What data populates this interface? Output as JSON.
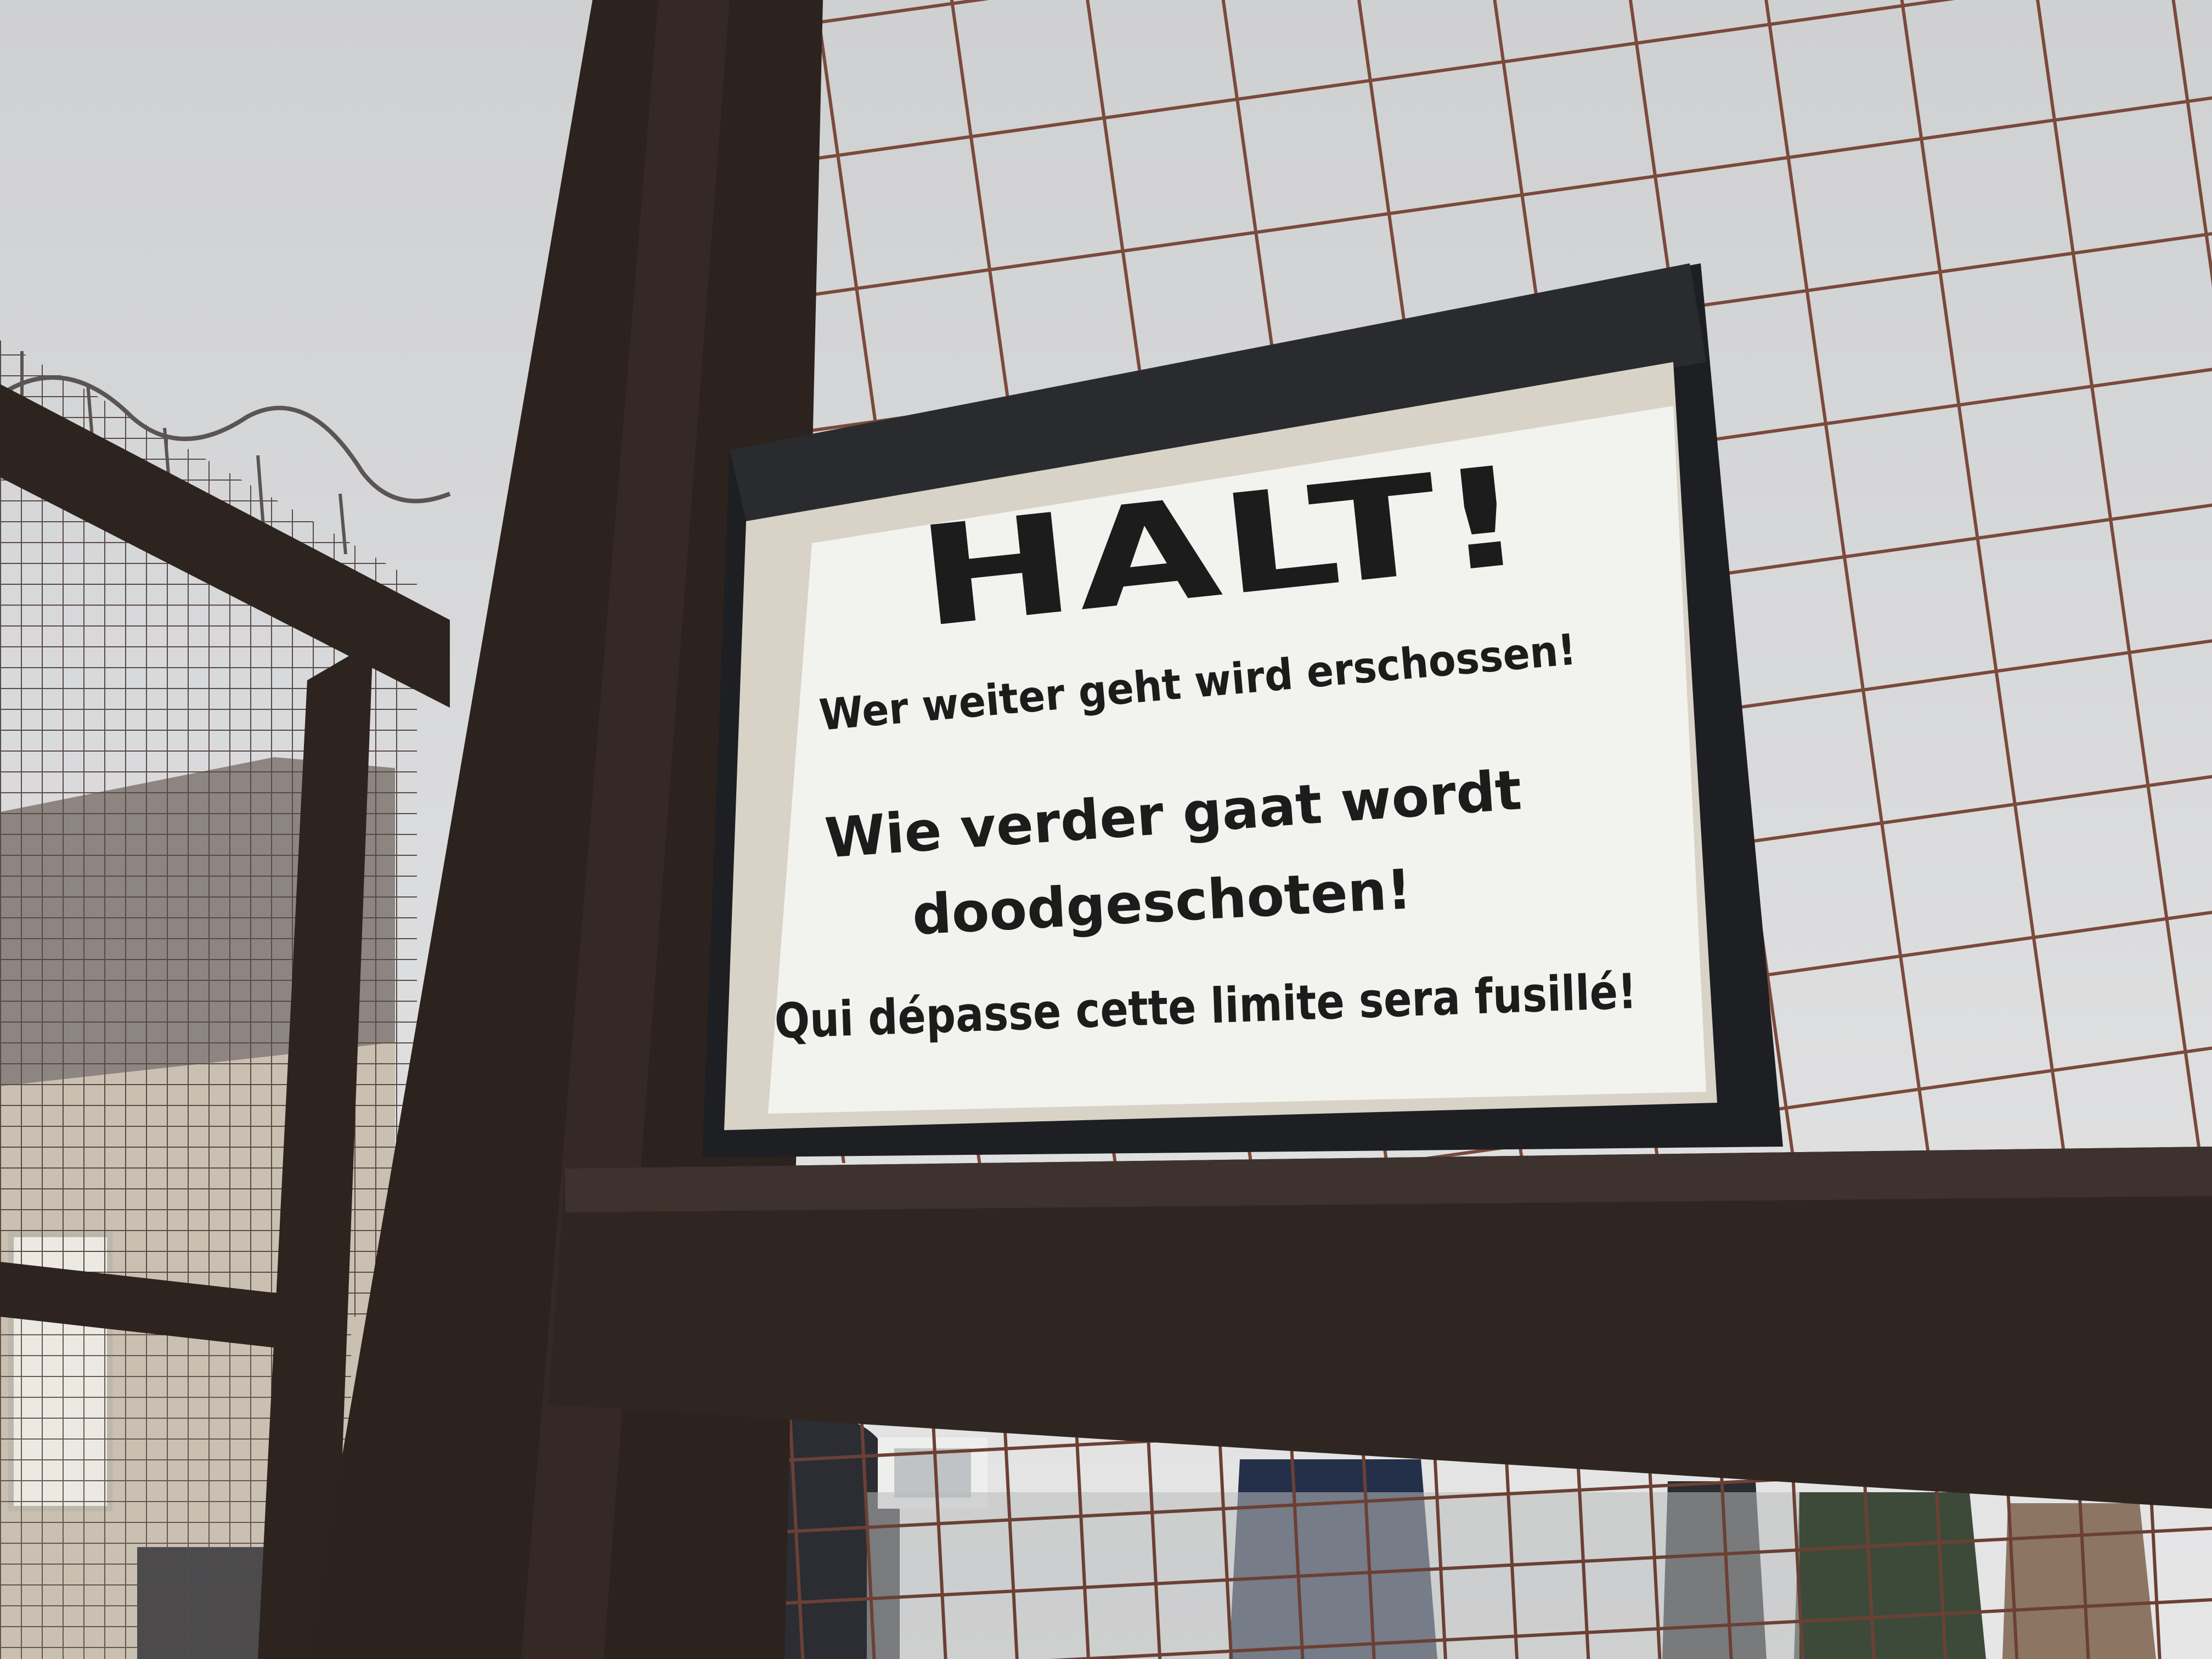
{
  "sign": {
    "heading": "HALT!",
    "line_german": "Wer weiter geht wird erschossen!",
    "line_dutch_1": "Wie verder gaat wordt",
    "line_dutch_2": "doodgeschoten!",
    "line_french": "Qui dépasse cette limite sera fusillé!"
  },
  "colors": {
    "sky": "#d9dadb",
    "wood": "#2e241f",
    "rust_mesh": "#7a4a3a",
    "sign_face": "#f2f2ef",
    "sign_text": "#1c1c1c"
  }
}
